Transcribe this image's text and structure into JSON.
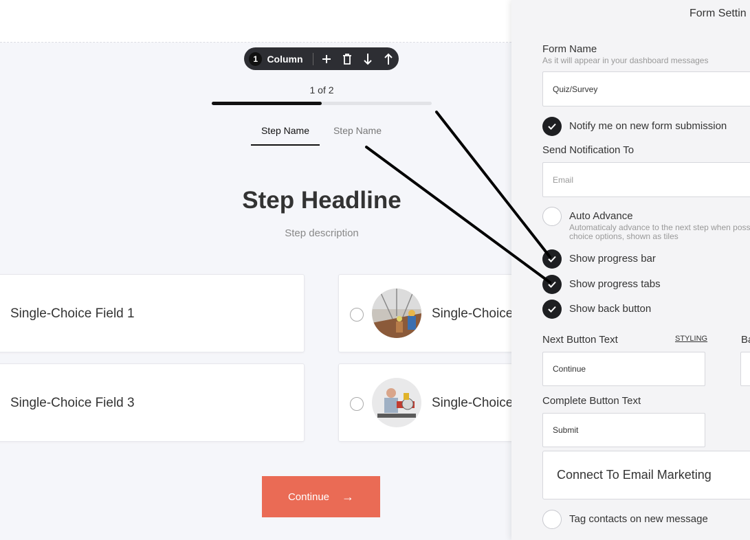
{
  "canvas": {
    "column_toolbar": {
      "count": "1",
      "label": "Column",
      "icons": [
        "add-icon",
        "trash-icon",
        "arrow-down-icon",
        "arrow-up-icon"
      ]
    },
    "progress": {
      "text": "1 of 2",
      "fraction": 0.5
    },
    "tabs": [
      "Step Name",
      "Step Name"
    ],
    "headline": "Step Headline",
    "description": "Step description",
    "choices": [
      {
        "label": "Single-Choice Field 1",
        "has_image": false
      },
      {
        "label": "Single-Choice",
        "has_image": true
      },
      {
        "label": "Single-Choice Field 3",
        "has_image": false
      },
      {
        "label": "Single-Choice",
        "has_image": true
      }
    ],
    "continue_button": {
      "label": "Continue",
      "arrow": "→"
    },
    "colors": {
      "accent": "#ea6b55",
      "dark": "#2d2e33"
    }
  },
  "panel": {
    "title": "Form Settin",
    "form_name": {
      "label": "Form Name",
      "hint": "As it will appear in your dashboard messages",
      "value": "Quiz/Survey"
    },
    "notify": {
      "label": "Notify me on new form submission",
      "checked": true
    },
    "send_to": {
      "label": "Send Notification To",
      "placeholder": "Email"
    },
    "auto_advance": {
      "label": "Auto Advance",
      "hint_line1": "Automaticaly advance to the next step when poss",
      "hint_line2": "choice options, shown as tiles",
      "checked": false
    },
    "show_progress_bar": {
      "label": "Show progress bar",
      "checked": true
    },
    "show_progress_tabs": {
      "label": "Show progress tabs",
      "checked": true
    },
    "show_back_button": {
      "label": "Show back button",
      "checked": true
    },
    "next_button": {
      "label": "Next Button Text",
      "styling": "STYLING",
      "value": "Continue"
    },
    "back_label_partial": "Ba",
    "complete_button": {
      "label": "Complete Button Text",
      "value": "Submit"
    },
    "connect": {
      "label": "Connect To Email Marketing"
    },
    "tag_contacts": {
      "label": "Tag contacts on new message",
      "checked": false
    }
  }
}
